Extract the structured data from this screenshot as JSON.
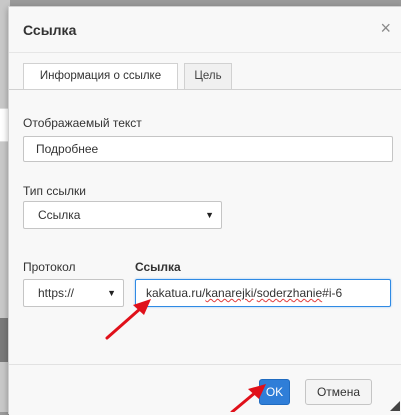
{
  "dialog": {
    "title": "Ссылка",
    "close_glyph": "×",
    "tabs": [
      {
        "label": "Информация о ссылке",
        "active": true
      },
      {
        "label": "Цель",
        "active": false
      }
    ]
  },
  "form": {
    "display_text_label": "Отображаемый текст",
    "display_text_value": "Подробнее",
    "link_type_label": "Тип ссылки",
    "link_type_value": "Ссылка",
    "protocol_label": "Протокол",
    "protocol_value": "https://",
    "url_label": "Ссылка",
    "url_value_part1": "kakatua.ru/",
    "url_value_part2": "kanarejki",
    "url_value_part3": "/",
    "url_value_part4": "soderzhanie",
    "url_value_part5": "#i-6"
  },
  "footer": {
    "ok_label": "OK",
    "cancel_label": "Отмена"
  },
  "colors": {
    "accent": "#2f7ed8",
    "annotation_arrow": "#e0101a"
  },
  "icons": {
    "close": "close-icon",
    "dropdown": "chevron-down-icon",
    "resize": "resize-grip-icon"
  }
}
